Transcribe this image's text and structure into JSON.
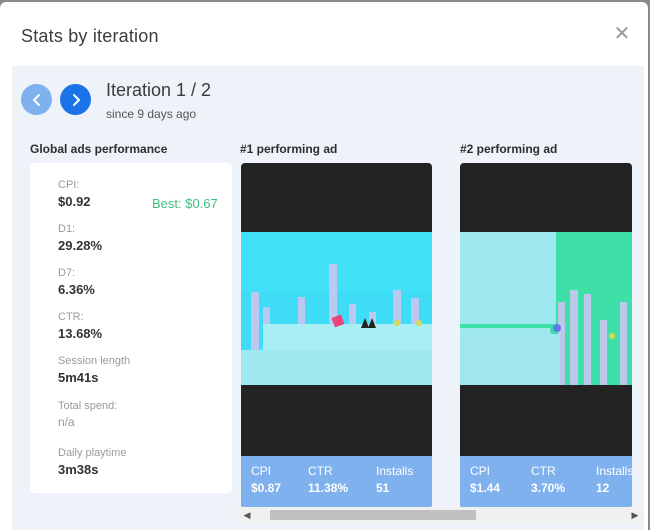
{
  "modal": {
    "title": "Stats by iteration",
    "close_icon": "close-icon"
  },
  "iteration": {
    "title": "Iteration 1 / 2",
    "since": "since 9 days ago"
  },
  "global": {
    "section_label": "Global ads performance",
    "cpi_label": "CPI:",
    "cpi_value": "$0.92",
    "best": "Best: $0.67",
    "d1_label": "D1:",
    "d1_value": "29.28%",
    "d7_label": "D7:",
    "d7_value": "6.36%",
    "ctr_label": "CTR:",
    "ctr_value": "13.68%",
    "session_label": "Session length",
    "session_value": "5m41s",
    "spend_label": "Total spend:",
    "spend_value": "n/a",
    "playtime_label": "Daily playtime",
    "playtime_value": "3m38s"
  },
  "ads": [
    {
      "label": "#1 performing ad",
      "cpi_label": "CPI",
      "cpi": "$0.87",
      "ctr_label": "CTR",
      "ctr": "11.38%",
      "installs_label": "Installs",
      "installs": "51"
    },
    {
      "label": "#2 performing ad",
      "cpi_label": "CPI",
      "cpi": "$1.44",
      "ctr_label": "CTR",
      "ctr": "3.70%",
      "installs_label": "Installs",
      "installs": "12"
    }
  ],
  "colors": {
    "accent": "#1a73e8",
    "accent_light": "#7fb1ef",
    "best_green": "#3cbf7a",
    "panel_bg": "#eef3fa"
  },
  "scroll": {
    "left_arrow": "◀",
    "right_arrow": "▶"
  }
}
